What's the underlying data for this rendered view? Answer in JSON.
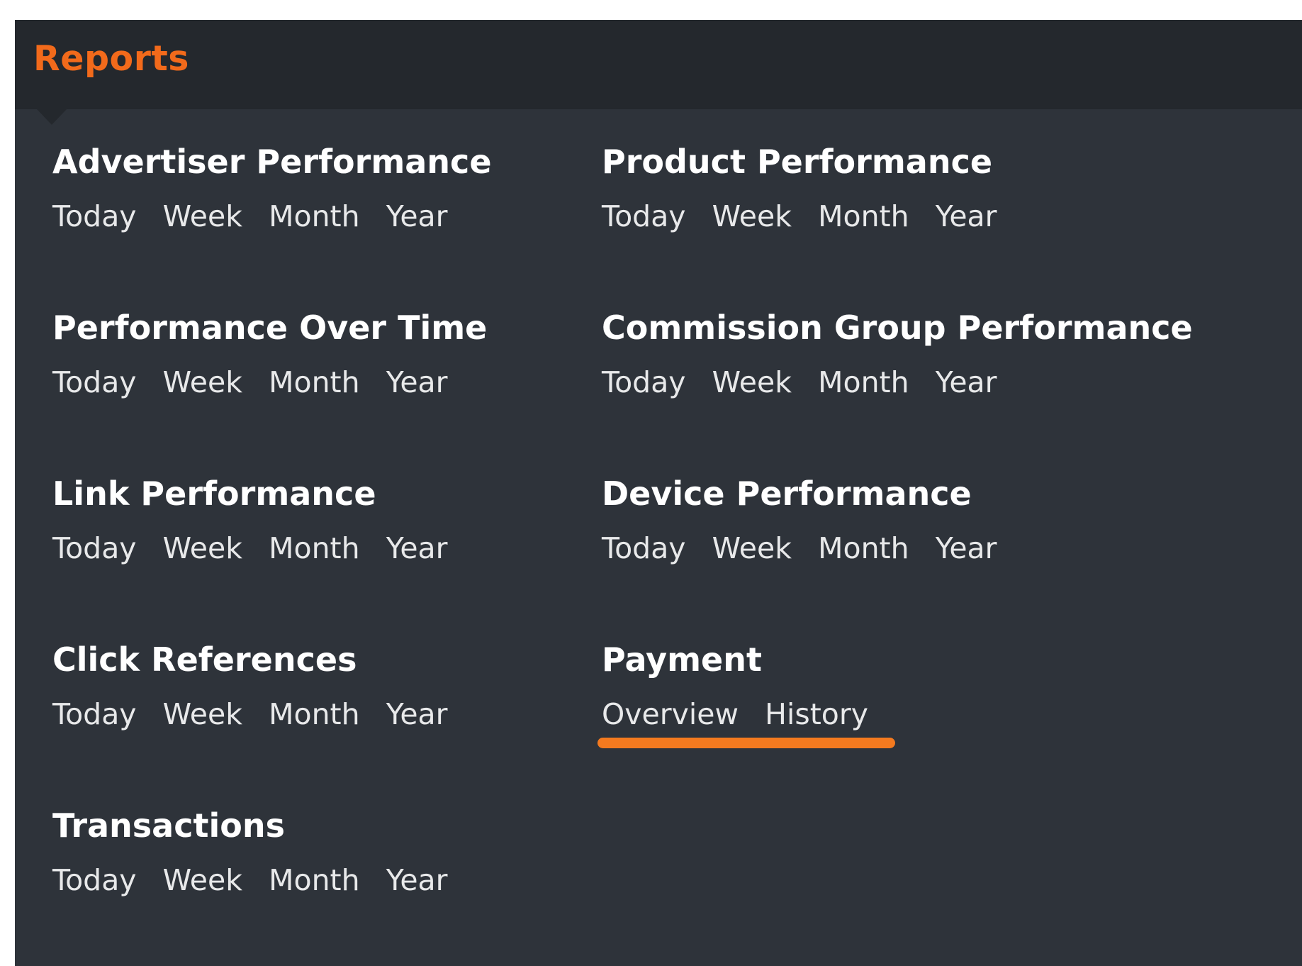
{
  "header": {
    "title": "Reports"
  },
  "colors": {
    "accent": "#f26a1b",
    "text": "#ffffff",
    "link": "#e8e9ea",
    "underline": "#f47a1f"
  },
  "sections": {
    "advertiser_performance": {
      "title": "Advertiser Performance",
      "links": [
        "Today",
        "Week",
        "Month",
        "Year"
      ]
    },
    "performance_over_time": {
      "title": "Performance Over Time",
      "links": [
        "Today",
        "Week",
        "Month",
        "Year"
      ]
    },
    "link_performance": {
      "title": "Link Performance",
      "links": [
        "Today",
        "Week",
        "Month",
        "Year"
      ]
    },
    "click_references": {
      "title": "Click References",
      "links": [
        "Today",
        "Week",
        "Month",
        "Year"
      ]
    },
    "transactions": {
      "title": "Transactions",
      "links": [
        "Today",
        "Week",
        "Month",
        "Year"
      ]
    },
    "product_performance": {
      "title": "Product Performance",
      "links": [
        "Today",
        "Week",
        "Month",
        "Year"
      ]
    },
    "commission_group_performance": {
      "title": "Commission Group Performance",
      "links": [
        "Today",
        "Week",
        "Month",
        "Year"
      ]
    },
    "device_performance": {
      "title": "Device Performance",
      "links": [
        "Today",
        "Week",
        "Month",
        "Year"
      ]
    },
    "payment": {
      "title": "Payment",
      "links": [
        "Overview",
        "History"
      ],
      "highlighted": true
    }
  }
}
